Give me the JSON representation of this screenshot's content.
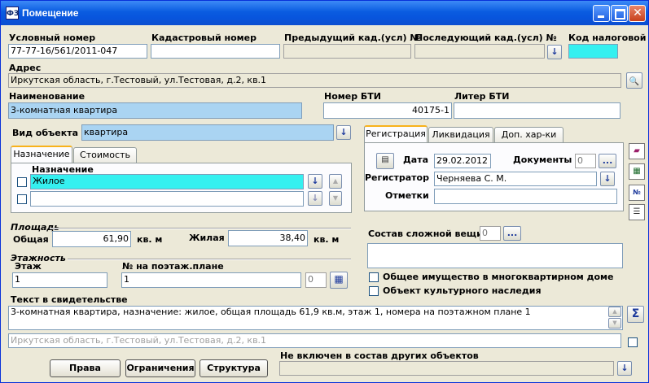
{
  "window": {
    "title": "Помещение"
  },
  "header": {
    "cond_num_label": "Условный номер",
    "cond_num_value": "77-77-16/561/2011-047",
    "cadastral_label": "Кадастровый номер",
    "cadastral_value": "",
    "prev_cad_label": "Предыдущий кад.(усл) №",
    "last_cad_label": "Последующий кад.(усл) №",
    "tax_code_label": "Код налоговой"
  },
  "address": {
    "label": "Адрес",
    "value": "Иркутская область, г.Тестовый, ул.Тестовая, д.2, кв.1"
  },
  "name": {
    "label": "Наименование",
    "value": "3-комнатная квартира"
  },
  "bti": {
    "num_label": "Номер БТИ",
    "num_value": "40175-1",
    "letter_label": "Литер БТИ",
    "letter_value": ""
  },
  "object_type": {
    "label": "Вид объекта",
    "value": "квартира"
  },
  "purpose_tabs": [
    {
      "label": "Назначение"
    },
    {
      "label": "Стоимость"
    }
  ],
  "purpose": {
    "header": "Назначение",
    "rows": [
      "Жилое",
      ""
    ]
  },
  "reg_tabs": [
    {
      "label": "Регистрация"
    },
    {
      "label": "Ликвидация"
    },
    {
      "label": "Доп. хар-ки"
    }
  ],
  "registration": {
    "date_label": "Дата",
    "date_value": "29.02.2012",
    "docs_label": "Документы",
    "docs_count": "0",
    "registrar_label": "Регистратор",
    "registrar_value": "Черняева С. М.",
    "marks_label": "Отметки",
    "marks_value": ""
  },
  "area": {
    "section": "Площадь",
    "total_label": "Общая",
    "total_value": "61,90",
    "unit": "кв. м",
    "living_label": "Жилая",
    "living_value": "38,40"
  },
  "floors": {
    "section": "Этажность",
    "floor_label": "Этаж",
    "floor_value": "1",
    "plan_label": "№ на поэтаж.плане",
    "plan_value": "1",
    "plan_count": "0"
  },
  "complex": {
    "label": "Состав сложной вещи",
    "count": "0",
    "value": ""
  },
  "flags": {
    "common_property": "Общее имущество в многоквартирном доме",
    "cultural_heritage": "Объект культурного наследия"
  },
  "certificate": {
    "label": "Текст в свидетельстве",
    "text": "3-комнатная квартира, назначение: жилое, общая площадь 61,9 кв.м, этаж 1, номера на поэтажном плане 1",
    "address_line": "Иркутская область, г.Тестовый, ул.Тестовая, д.2, кв.1"
  },
  "buttons": {
    "rights": "Права",
    "restrictions": "Ограничения",
    "structure": "Структура",
    "ellipsis": "..."
  },
  "not_included": {
    "label": "Не включен в состав других объектов",
    "value": ""
  },
  "icons": {
    "down": "↓",
    "up_arrow": "▲",
    "down_arrow": "▼",
    "sigma": "Σ",
    "binocular": "🔍"
  }
}
